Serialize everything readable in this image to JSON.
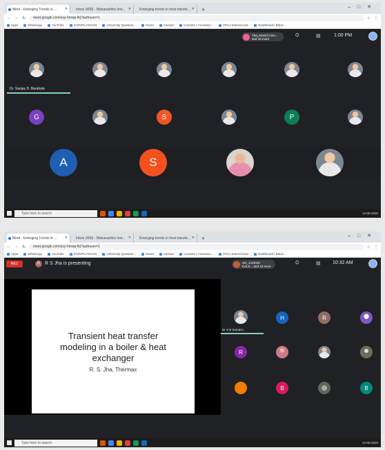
{
  "browser": {
    "tabs": [
      "Meet - Emerging Trends in ...",
      "Inbox (409) - Maharashtra Inst...",
      "Emerging trends in heat transfe..."
    ],
    "url": "meet.google.com/ssy-hmwp-fkj?authuser=1",
    "bookmarks": [
      "Apps",
      "WhatsApp",
      "YouTube",
      "ICMVPL/ASCOS",
      "University Question...",
      "Novel",
      "Canvas",
      "Courses | Coursera...",
      "VPLU Internal Use",
      "Dashboard | Black..."
    ]
  },
  "screen1": {
    "participants_chip": "TIM_MANOJ MA... and 16 more",
    "time": "1:00 PM",
    "speaker": "Dr. Sanjay D. Barahate",
    "row2_letters": [
      "G",
      "S",
      "P"
    ],
    "row3_letters": [
      "A",
      "S"
    ],
    "colors": {
      "G": "#7b3fbf",
      "S": "#ef5722",
      "P": "#0b7d55",
      "A": "#1e5fb4",
      "S2": "#f4511e"
    }
  },
  "screen2": {
    "rec": "REC",
    "presenter_initial": "R",
    "presenter_text": "R S Jha is presenting",
    "participants_chip": "SG_JAVESH KALK... and 19 more",
    "time": "10:32 AM",
    "slide_title": "Transient heat transfer modeling in a boiler & heat exchanger",
    "slide_subtitle": "R. S. Jha, Thermax",
    "speaker": "Dr S B Somani...",
    "side_letters": [
      "H",
      "R",
      "R",
      "B",
      "B"
    ]
  },
  "taskbar": {
    "search_placeholder": "Type here to search",
    "date1": "13-08-2020",
    "date2": "14-08-2020"
  }
}
